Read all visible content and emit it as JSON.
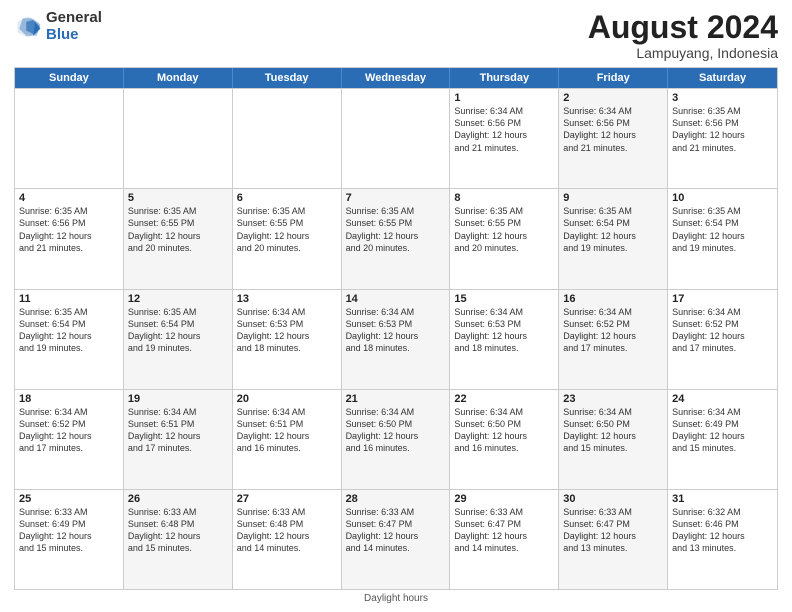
{
  "logo": {
    "general": "General",
    "blue": "Blue"
  },
  "title": "August 2024",
  "location": "Lampuyang, Indonesia",
  "days": [
    "Sunday",
    "Monday",
    "Tuesday",
    "Wednesday",
    "Thursday",
    "Friday",
    "Saturday"
  ],
  "footer": "Daylight hours",
  "weeks": [
    [
      {
        "day": "",
        "info": "",
        "shade": false
      },
      {
        "day": "",
        "info": "",
        "shade": false
      },
      {
        "day": "",
        "info": "",
        "shade": false
      },
      {
        "day": "",
        "info": "",
        "shade": false
      },
      {
        "day": "1",
        "info": "Sunrise: 6:34 AM\nSunset: 6:56 PM\nDaylight: 12 hours\nand 21 minutes.",
        "shade": false
      },
      {
        "day": "2",
        "info": "Sunrise: 6:34 AM\nSunset: 6:56 PM\nDaylight: 12 hours\nand 21 minutes.",
        "shade": true
      },
      {
        "day": "3",
        "info": "Sunrise: 6:35 AM\nSunset: 6:56 PM\nDaylight: 12 hours\nand 21 minutes.",
        "shade": false
      }
    ],
    [
      {
        "day": "4",
        "info": "Sunrise: 6:35 AM\nSunset: 6:56 PM\nDaylight: 12 hours\nand 21 minutes.",
        "shade": false
      },
      {
        "day": "5",
        "info": "Sunrise: 6:35 AM\nSunset: 6:55 PM\nDaylight: 12 hours\nand 20 minutes.",
        "shade": true
      },
      {
        "day": "6",
        "info": "Sunrise: 6:35 AM\nSunset: 6:55 PM\nDaylight: 12 hours\nand 20 minutes.",
        "shade": false
      },
      {
        "day": "7",
        "info": "Sunrise: 6:35 AM\nSunset: 6:55 PM\nDaylight: 12 hours\nand 20 minutes.",
        "shade": true
      },
      {
        "day": "8",
        "info": "Sunrise: 6:35 AM\nSunset: 6:55 PM\nDaylight: 12 hours\nand 20 minutes.",
        "shade": false
      },
      {
        "day": "9",
        "info": "Sunrise: 6:35 AM\nSunset: 6:54 PM\nDaylight: 12 hours\nand 19 minutes.",
        "shade": true
      },
      {
        "day": "10",
        "info": "Sunrise: 6:35 AM\nSunset: 6:54 PM\nDaylight: 12 hours\nand 19 minutes.",
        "shade": false
      }
    ],
    [
      {
        "day": "11",
        "info": "Sunrise: 6:35 AM\nSunset: 6:54 PM\nDaylight: 12 hours\nand 19 minutes.",
        "shade": false
      },
      {
        "day": "12",
        "info": "Sunrise: 6:35 AM\nSunset: 6:54 PM\nDaylight: 12 hours\nand 19 minutes.",
        "shade": true
      },
      {
        "day": "13",
        "info": "Sunrise: 6:34 AM\nSunset: 6:53 PM\nDaylight: 12 hours\nand 18 minutes.",
        "shade": false
      },
      {
        "day": "14",
        "info": "Sunrise: 6:34 AM\nSunset: 6:53 PM\nDaylight: 12 hours\nand 18 minutes.",
        "shade": true
      },
      {
        "day": "15",
        "info": "Sunrise: 6:34 AM\nSunset: 6:53 PM\nDaylight: 12 hours\nand 18 minutes.",
        "shade": false
      },
      {
        "day": "16",
        "info": "Sunrise: 6:34 AM\nSunset: 6:52 PM\nDaylight: 12 hours\nand 17 minutes.",
        "shade": true
      },
      {
        "day": "17",
        "info": "Sunrise: 6:34 AM\nSunset: 6:52 PM\nDaylight: 12 hours\nand 17 minutes.",
        "shade": false
      }
    ],
    [
      {
        "day": "18",
        "info": "Sunrise: 6:34 AM\nSunset: 6:52 PM\nDaylight: 12 hours\nand 17 minutes.",
        "shade": false
      },
      {
        "day": "19",
        "info": "Sunrise: 6:34 AM\nSunset: 6:51 PM\nDaylight: 12 hours\nand 17 minutes.",
        "shade": true
      },
      {
        "day": "20",
        "info": "Sunrise: 6:34 AM\nSunset: 6:51 PM\nDaylight: 12 hours\nand 16 minutes.",
        "shade": false
      },
      {
        "day": "21",
        "info": "Sunrise: 6:34 AM\nSunset: 6:50 PM\nDaylight: 12 hours\nand 16 minutes.",
        "shade": true
      },
      {
        "day": "22",
        "info": "Sunrise: 6:34 AM\nSunset: 6:50 PM\nDaylight: 12 hours\nand 16 minutes.",
        "shade": false
      },
      {
        "day": "23",
        "info": "Sunrise: 6:34 AM\nSunset: 6:50 PM\nDaylight: 12 hours\nand 15 minutes.",
        "shade": true
      },
      {
        "day": "24",
        "info": "Sunrise: 6:34 AM\nSunset: 6:49 PM\nDaylight: 12 hours\nand 15 minutes.",
        "shade": false
      }
    ],
    [
      {
        "day": "25",
        "info": "Sunrise: 6:33 AM\nSunset: 6:49 PM\nDaylight: 12 hours\nand 15 minutes.",
        "shade": false
      },
      {
        "day": "26",
        "info": "Sunrise: 6:33 AM\nSunset: 6:48 PM\nDaylight: 12 hours\nand 15 minutes.",
        "shade": true
      },
      {
        "day": "27",
        "info": "Sunrise: 6:33 AM\nSunset: 6:48 PM\nDaylight: 12 hours\nand 14 minutes.",
        "shade": false
      },
      {
        "day": "28",
        "info": "Sunrise: 6:33 AM\nSunset: 6:47 PM\nDaylight: 12 hours\nand 14 minutes.",
        "shade": true
      },
      {
        "day": "29",
        "info": "Sunrise: 6:33 AM\nSunset: 6:47 PM\nDaylight: 12 hours\nand 14 minutes.",
        "shade": false
      },
      {
        "day": "30",
        "info": "Sunrise: 6:33 AM\nSunset: 6:47 PM\nDaylight: 12 hours\nand 13 minutes.",
        "shade": true
      },
      {
        "day": "31",
        "info": "Sunrise: 6:32 AM\nSunset: 6:46 PM\nDaylight: 12 hours\nand 13 minutes.",
        "shade": false
      }
    ]
  ]
}
